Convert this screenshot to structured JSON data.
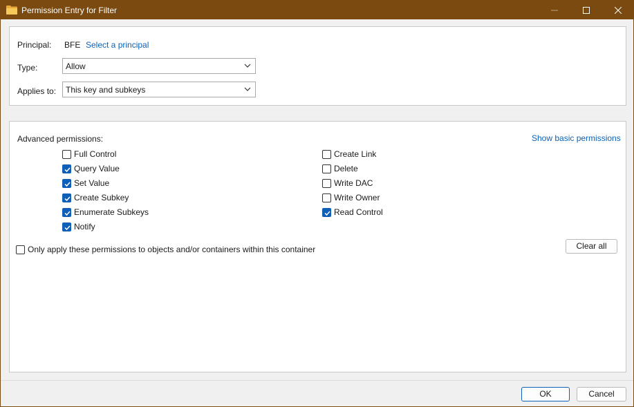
{
  "window": {
    "title": "Permission Entry for Filter",
    "title_icon": "folder-icon",
    "controls": [
      "minimize-icon",
      "maximize-icon",
      "close-icon"
    ]
  },
  "principal": {
    "label": "Principal:",
    "value": "BFE",
    "link": "Select a principal"
  },
  "type": {
    "label": "Type:",
    "value": "Allow"
  },
  "applies_to": {
    "label": "Applies to:",
    "value": "This key and subkeys"
  },
  "advanced": {
    "heading": "Advanced permissions:",
    "toggle_link": "Show basic permissions",
    "left_column": [
      {
        "label": "Full Control",
        "checked": false
      },
      {
        "label": "Query Value",
        "checked": true
      },
      {
        "label": "Set Value",
        "checked": true
      },
      {
        "label": "Create Subkey",
        "checked": true
      },
      {
        "label": "Enumerate Subkeys",
        "checked": true
      },
      {
        "label": "Notify",
        "checked": true
      }
    ],
    "right_column": [
      {
        "label": "Create Link",
        "checked": false
      },
      {
        "label": "Delete",
        "checked": false
      },
      {
        "label": "Write DAC",
        "checked": false
      },
      {
        "label": "Write Owner",
        "checked": false
      },
      {
        "label": "Read Control",
        "checked": true
      }
    ],
    "only_apply": {
      "label": "Only apply these permissions to objects and/or containers within this container",
      "checked": false
    },
    "clear_all": "Clear all"
  },
  "footer": {
    "ok": "OK",
    "cancel": "Cancel"
  },
  "colors": {
    "titlebar": "#7a4a10",
    "accent": "#0e5fb8",
    "link": "#0a62b8"
  }
}
